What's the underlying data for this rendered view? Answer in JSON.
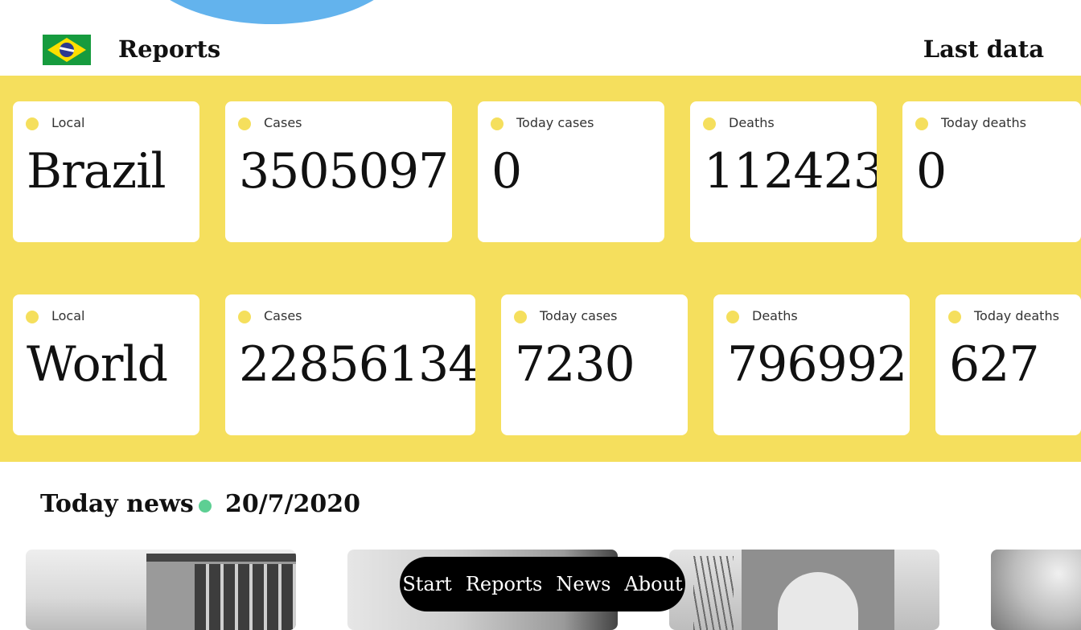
{
  "header": {
    "title": "Reports",
    "last_data": "Last data",
    "flag_icon": "brazil-flag-icon"
  },
  "colors": {
    "accent_yellow": "#f5df5d",
    "accent_blue": "#63b3ed",
    "accent_green": "#5dcf93"
  },
  "rows": [
    {
      "cards": [
        {
          "label": "Local",
          "value": "Brazil"
        },
        {
          "label": "Cases",
          "value": "3505097"
        },
        {
          "label": "Today cases",
          "value": "0"
        },
        {
          "label": "Deaths",
          "value": "112423"
        },
        {
          "label": "Today deaths",
          "value": "0"
        }
      ]
    },
    {
      "cards": [
        {
          "label": "Local",
          "value": "World"
        },
        {
          "label": "Cases",
          "value": "22856134"
        },
        {
          "label": "Today cases",
          "value": "7230"
        },
        {
          "label": "Deaths",
          "value": "796992"
        },
        {
          "label": "Today deaths",
          "value": "627"
        }
      ]
    }
  ],
  "news": {
    "title": "Today news",
    "date": "20/7/2020"
  },
  "nav": {
    "items": [
      "Start",
      "Reports",
      "News",
      "About"
    ]
  }
}
